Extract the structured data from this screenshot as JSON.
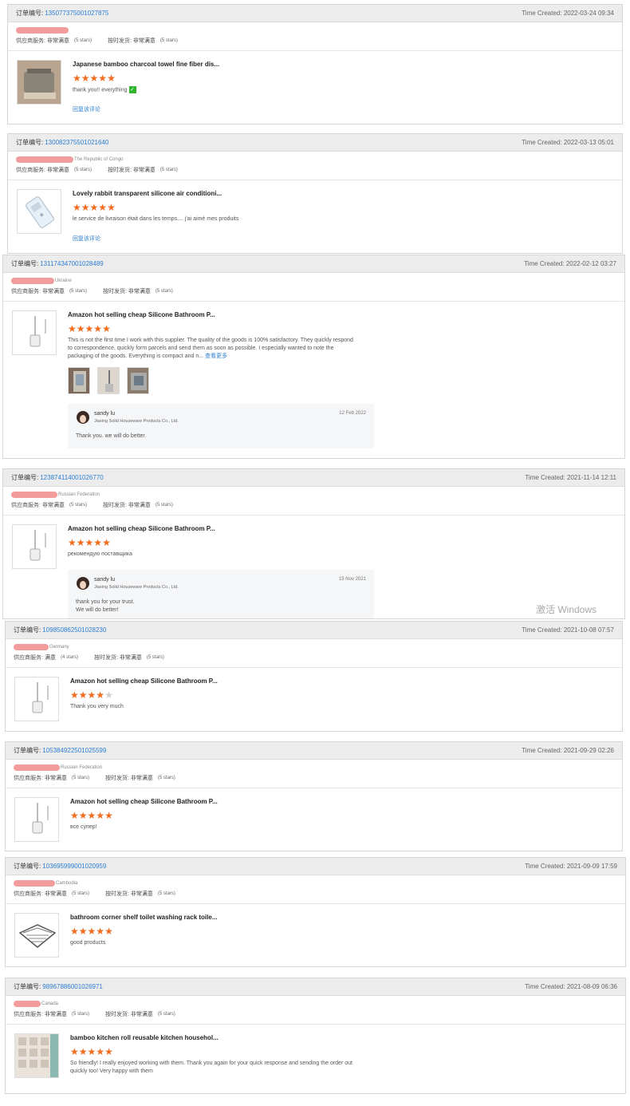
{
  "labels": {
    "order_no": "订单编号:",
    "time_created": "Time Created:",
    "supplier_service": "供应商服务:",
    "on_time_shipping": "按时发货:",
    "reply_review": "回复该评论",
    "see_more": "查看更多"
  },
  "orders": [
    {
      "order_id": "135077375001027875",
      "time": "2022-03-24 09:34",
      "country": "",
      "supplier_value": "非常满意",
      "supplier_stars": "(5 stars)",
      "shipping_value": "非常满意",
      "shipping_stars": "(5 stars)",
      "product_title": "Japanese bamboo charcoal towel fine fiber dis...",
      "rating": 5,
      "review": "thank you!! everything",
      "reply_link": "回复该评论"
    },
    {
      "order_id": "130082375501021640",
      "time": "2022-03-13 05:01",
      "country": "The Republic of Congo",
      "supplier_value": "非常满意",
      "supplier_stars": "(5 stars)",
      "shipping_value": "非常满意",
      "shipping_stars": "(5 stars)",
      "product_title": "Lovely rabbit transparent silicone air conditioni...",
      "rating": 5,
      "review": "le service de livraison était dans les temps.... j'ai aimé mes produits",
      "reply_link": "回复该评论"
    },
    {
      "order_id": "131174347001028489",
      "time": "2022-02-12 03:27",
      "country": "Ukraine",
      "supplier_value": "非常满意",
      "supplier_stars": "(5 stars)",
      "shipping_value": "非常满意",
      "shipping_stars": "(5 stars)",
      "product_title": "Amazon hot selling cheap Silicone Bathroom P...",
      "rating": 5,
      "review": "This is not the first time I work with this supplier. The quality of the goods is 100% satisfactory. They quickly respond to correspondence, quickly form parcels and send them as soon as possible. I especially wanted to note the packaging of the goods. Everything is compact and n...",
      "see_more": "查看更多",
      "reply": {
        "name": "sandy lu",
        "company": "Jiaxing Solid Houseware Products Co., Ltd.",
        "date": "12 Feb 2022",
        "text": "Thank you. we will do better."
      }
    },
    {
      "order_id": "123874114001026770",
      "time": "2021-11-14 12:11",
      "country": "Russian Federation",
      "supplier_value": "非常满意",
      "supplier_stars": "(5 stars)",
      "shipping_value": "非常满意",
      "shipping_stars": "(5 stars)",
      "product_title": "Amazon hot selling cheap Silicone Bathroom P...",
      "rating": 5,
      "review": "рекомендую поставщика",
      "reply": {
        "name": "sandy lu",
        "company": "Jiaxing Solid Houseware Products Co., Ltd.",
        "date": "15 Nov 2021",
        "text1": "thank you for your trust.",
        "text2": "We will do better!"
      }
    },
    {
      "order_id": "109850862501028230",
      "time": "2021-10-08 07:57",
      "country": "Germany",
      "supplier_value": "满意",
      "supplier_stars": "(4 stars)",
      "shipping_value": "非常满意",
      "shipping_stars": "(5 stars)",
      "product_title": "Amazon hot selling cheap Silicone Bathroom P...",
      "rating": 4,
      "review": "Thank you very much"
    },
    {
      "order_id": "105384922501025599",
      "time": "2021-09-29 02:26",
      "country": "Russian Federation",
      "supplier_value": "非常满意",
      "supplier_stars": "(5 stars)",
      "shipping_value": "非常满意",
      "shipping_stars": "(5 stars)",
      "product_title": "Amazon hot selling cheap Silicone Bathroom P...",
      "rating": 5,
      "review": "все супер!"
    },
    {
      "order_id": "103695999001020959",
      "time": "2021-09-09 17:59",
      "country": "Cambodia",
      "supplier_value": "非常满意",
      "supplier_stars": "(5 stars)",
      "shipping_value": "非常满意",
      "shipping_stars": "(5 stars)",
      "product_title": "bathroom corner shelf toilet washing rack toile...",
      "rating": 5,
      "review": "good products"
    },
    {
      "order_id": "98967886001026971",
      "time": "2021-08-09 06:36",
      "country": "Canada",
      "supplier_value": "非常满意",
      "supplier_stars": "(5 stars)",
      "shipping_value": "非常满意",
      "shipping_stars": "(5 stars)",
      "product_title": "bamboo kitchen roll reusable kitchen househol...",
      "rating": 5,
      "review": "So friendly!  I really enjoyed working with them.  Thank you again for your quick response and sending the order out quickly too!  Very happy with them"
    }
  ],
  "watermark": "激活 Windows",
  "colors": {
    "link": "#2d7fd3",
    "star": "#f36b1d",
    "header_bg": "#ececec"
  }
}
